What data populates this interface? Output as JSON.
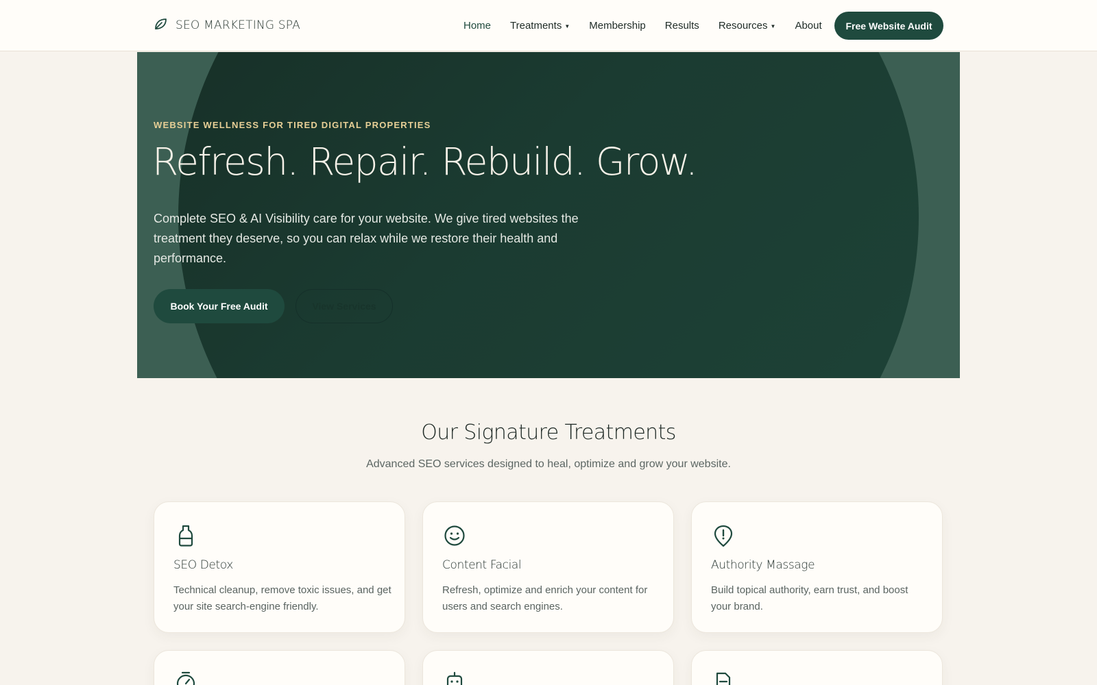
{
  "header": {
    "brand": "SEO MARKETING SPA",
    "brand_icon": "leaf-icon",
    "nav": [
      {
        "label": "Home",
        "active": true
      },
      {
        "label": "Treatments",
        "dropdown": true
      },
      {
        "label": "Membership"
      },
      {
        "label": "Results"
      },
      {
        "label": "Resources",
        "dropdown": true
      },
      {
        "label": "About"
      }
    ],
    "cta_label": "Free Website Audit"
  },
  "hero": {
    "eyebrow": "WEBSITE WELLNESS FOR TIRED DIGITAL PROPERTIES",
    "title": "Refresh. Repair. Rebuild. Grow.",
    "description": "Complete SEO & AI Visibility care for your website. We give tired websites the treatment they deserve, so you can relax while we restore their health and performance.",
    "primary_button": "Book Your Free Audit",
    "secondary_button": "View Services"
  },
  "treatments": {
    "title": "Our Signature Treatments",
    "subtitle": "Advanced SEO services designed to heal, optimize and grow your website.",
    "cards": [
      {
        "icon": "bottle-icon",
        "title": "SEO Detox",
        "description": "Technical cleanup, remove toxic issues, and get your site search-engine friendly."
      },
      {
        "icon": "smiley-face-icon",
        "title": "Content Facial",
        "description": "Refresh, optimize and enrich your content for users and search engines."
      },
      {
        "icon": "alert-pin-icon",
        "title": "Authority Massage",
        "description": "Build topical authority, earn trust, and boost your brand."
      },
      {
        "icon": "stopwatch-icon"
      },
      {
        "icon": "robot-icon"
      },
      {
        "icon": "document-icon"
      }
    ]
  },
  "colors": {
    "primary": "#1f4a3e",
    "hero_dark": "#1b3b31",
    "accent_gold": "#e7cf96",
    "background": "#f7f3ed",
    "card_bg": "#fffdf9"
  }
}
